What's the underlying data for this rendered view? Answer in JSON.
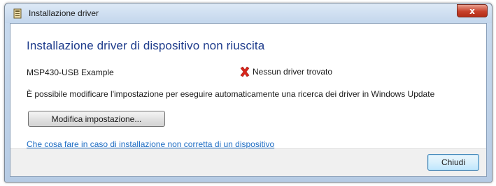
{
  "window": {
    "title": "Installazione driver",
    "close_glyph": "x"
  },
  "main": {
    "heading": "Installazione driver di dispositivo non riuscita",
    "device_name": "MSP430-USB Example",
    "status_text": "Nessun driver trovato",
    "status_icon": "error-x-icon",
    "status_color": "#d9261c",
    "info_text": "È possibile modificare l'impostazione per eseguire automaticamente una ricerca dei driver in Windows Update",
    "modify_button_label": "Modifica impostazione...",
    "help_link_text": "Che cosa fare in caso di installazione non corretta di un dispositivo"
  },
  "footer": {
    "close_button_label": "Chiudi"
  },
  "colors": {
    "heading": "#1e3c8c",
    "link": "#1c6cc4",
    "title_close": "#c7412b"
  }
}
